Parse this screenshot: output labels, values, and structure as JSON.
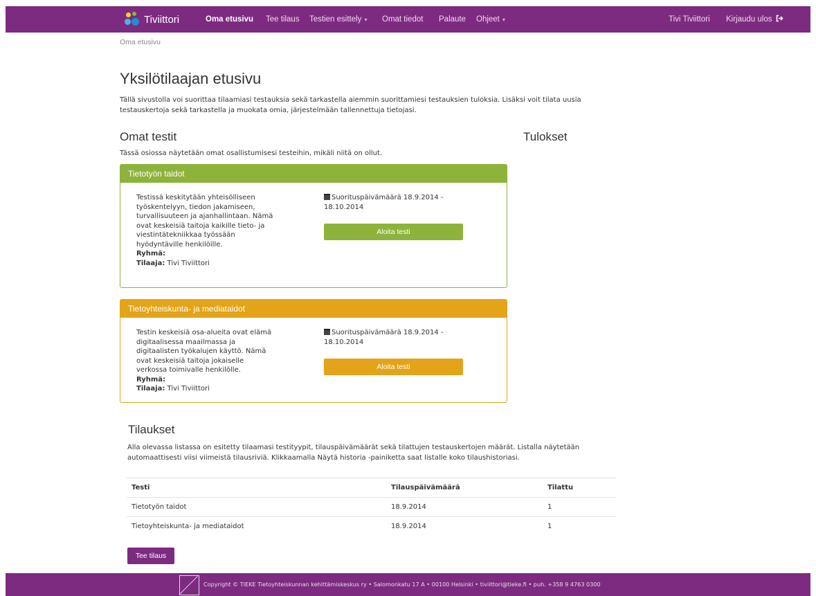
{
  "navbar": {
    "brand": "Tiviittori",
    "items": [
      {
        "label": "Oma etusivu",
        "active": true
      },
      {
        "label": "Tee tilaus"
      },
      {
        "label": "Testien esittely",
        "dropdown": true
      },
      {
        "label": "Omat tiedot"
      },
      {
        "label": "Palaute"
      },
      {
        "label": "Ohjeet",
        "dropdown": true
      }
    ],
    "user_name": "Tivi Tiviittori",
    "logout_label": "Kirjaudu ulos",
    "logout_icon": "sign-out-icon",
    "caret": "▾",
    "color": "#7d2b80"
  },
  "breadcrumb": "Oma etusivu",
  "page": {
    "title": "Yksilötilaajan etusivu",
    "intro": "Tällä sivustolla voi suorittaa tilaamiasi testauksia sekä tarkastella aiemmin suorittamiesi testauksien tuloksia. Lisäksi voit tilata uusia testauskertoja sekä tarkastella ja muokata omia, järjestelmään tallennettuja tietojasi."
  },
  "my_tests": {
    "heading": "Omat testit",
    "description": "Tässä osiossa näytetään omat osallistumisesi testeihin, mikäli niitä on ollut.",
    "cards": [
      {
        "title": "Tietotyön taidot",
        "color": "#8db33a",
        "text": "Testissä keskitytään yhteisölliseen työskentelyyn, tiedon jakamiseen, turvallisuuteen ja ajanhallintaan. Nämä ovat keskeisiä taitoja kaikille tieto- ja viestintätekniikkaa työssään hyödyntäville henkilöille.",
        "group_label": "Ryhmä:",
        "group_value": "",
        "orderer_label": "Tilaaja:",
        "orderer_value": "Tivi Tiviittori",
        "date": "Suorituspäivämäärä 18.9.2014 - 18.10.2014",
        "button": "Aloita testi"
      },
      {
        "title": "Tietoyhteiskunta- ja mediataidot",
        "color": "#e3a41a",
        "text": "Testin keskeisiä osa-alueita ovat elämä digitaalisessa maailmassa ja digitaalisten työkalujen käyttö. Nämä ovat keskeisiä taitoja jokaiselle verkossa toimivalle henkilölle.",
        "group_label": "Ryhmä:",
        "group_value": "",
        "orderer_label": "Tilaaja:",
        "orderer_value": "Tivi Tiviittori",
        "date": "Suorituspäivämäärä 18.9.2014 - 18.10.2014",
        "button": "Aloita testi"
      }
    ]
  },
  "results": {
    "heading": "Tulokset"
  },
  "orders": {
    "heading": "Tilaukset",
    "description": "Alla olevassa listassa on esitetty tilaamasi testityypit, tilauspäivämäärät sekä tilattujen testauskertojen määrät. Listalla näytetään automaattisesti viisi viimeistä tilausriviä. Klikkaamalla Näytä historia -painiketta saat listalle koko tilaushistoriasi.",
    "columns": [
      "Testi",
      "Tilauspäivämäärä",
      "Tilattu"
    ],
    "rows": [
      [
        "Tietotyön taidot",
        "18.9.2014",
        "1"
      ],
      [
        "Tietoyhteiskunta- ja mediataidot",
        "18.9.2014",
        "1"
      ]
    ],
    "button": "Tee tilaus"
  },
  "footer": {
    "text": "Copyright © TIEKE Tietoyhteiskunnan kehittämiskeskus ry • Salomonkatu 17 A • 00100 Helsinki • tiviittori@tieke.fi • puh. +358 9 4763 0300"
  }
}
